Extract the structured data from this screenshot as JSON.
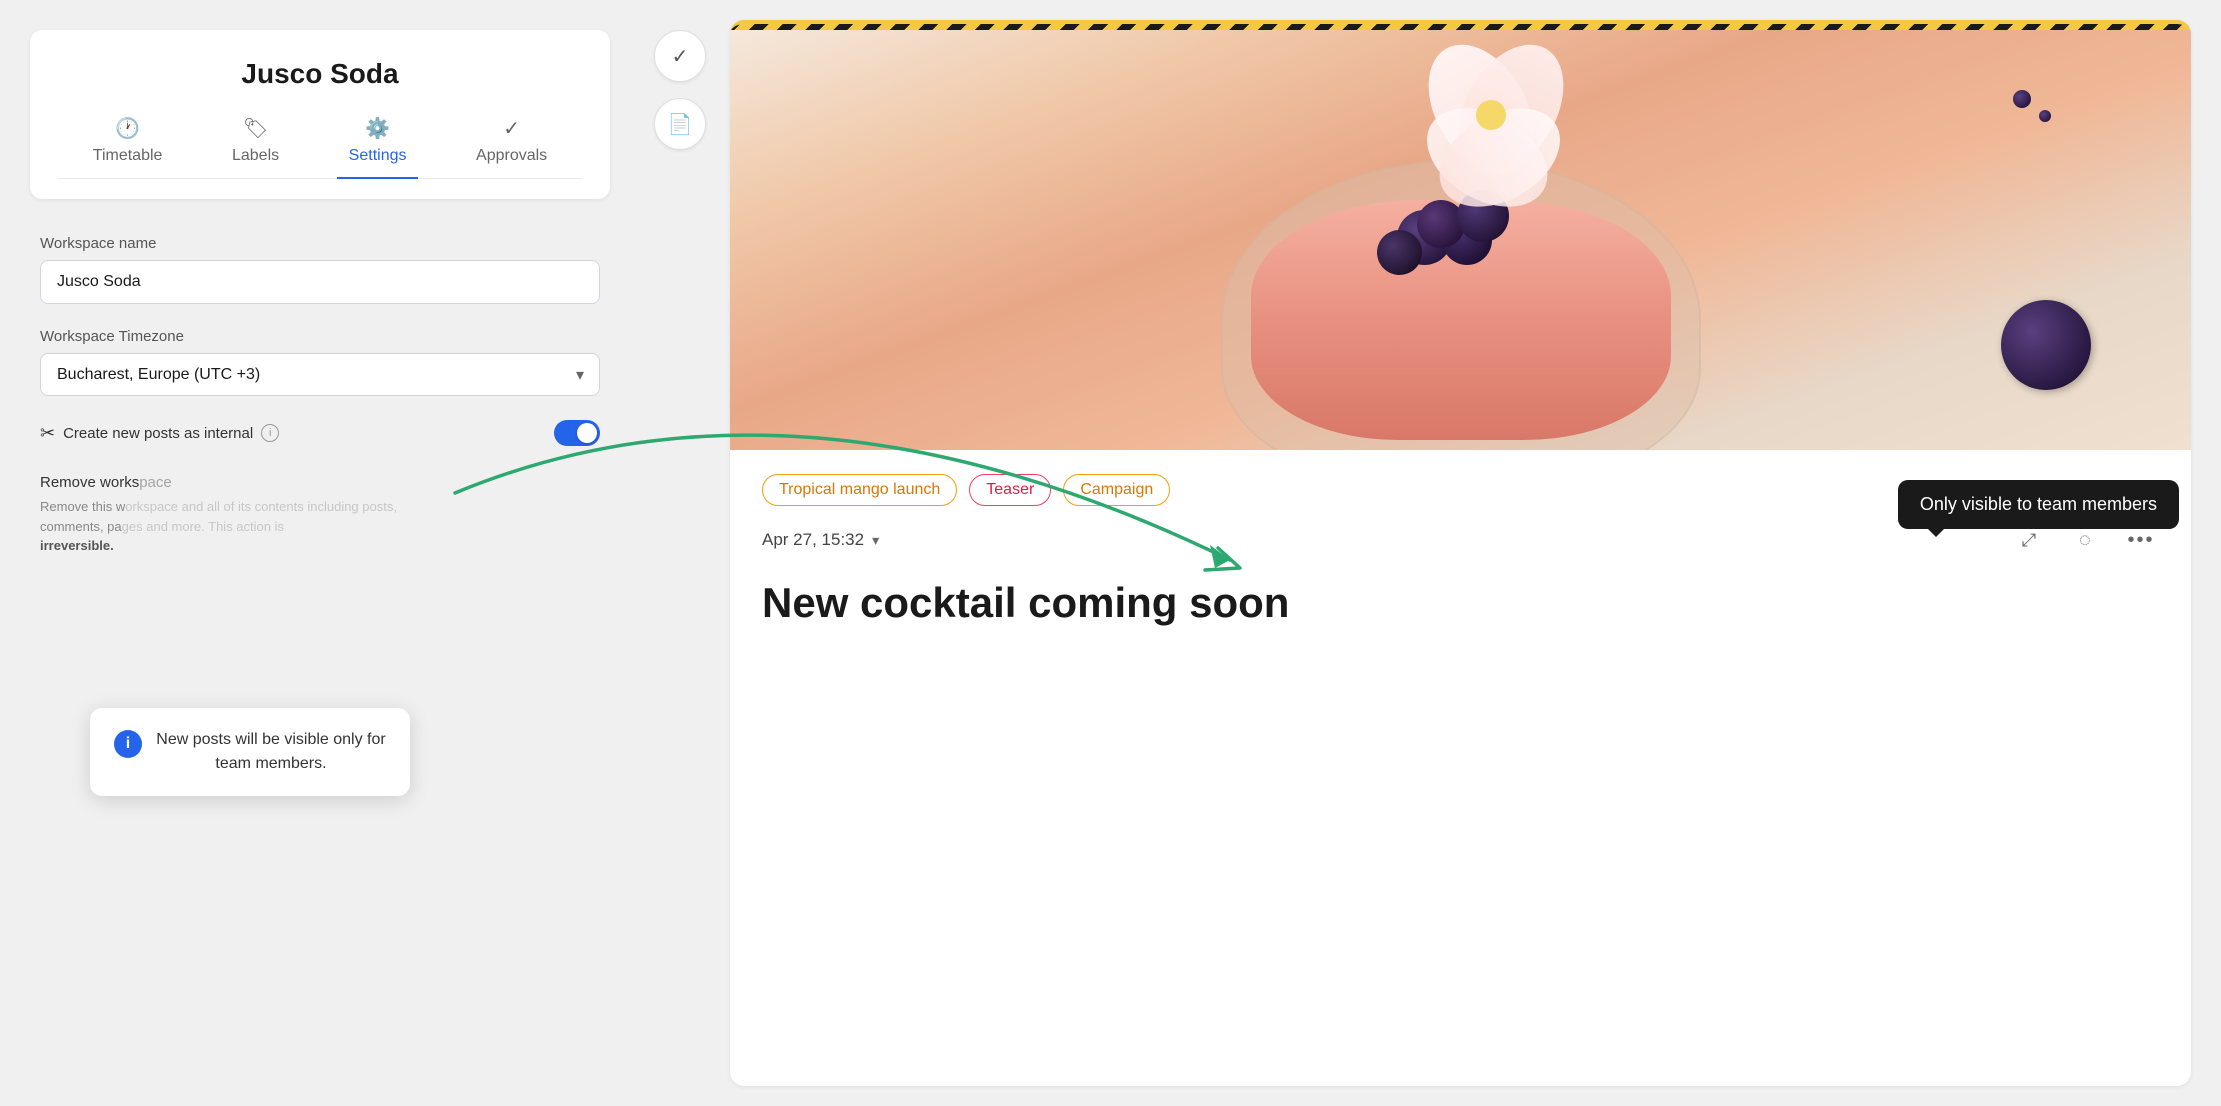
{
  "workspace": {
    "title": "Jusco Soda"
  },
  "tabs": [
    {
      "id": "timetable",
      "label": "Timetable",
      "icon": "🕐",
      "active": false
    },
    {
      "id": "labels",
      "label": "Labels",
      "icon": "🏷",
      "active": false
    },
    {
      "id": "settings",
      "label": "Settings",
      "icon": "⚙️",
      "active": true
    },
    {
      "id": "approvals",
      "label": "Approvals",
      "icon": "✓",
      "active": false
    }
  ],
  "settings": {
    "workspace_name_label": "Workspace name",
    "workspace_name_value": "Jusco Soda",
    "workspace_timezone_label": "Workspace Timezone",
    "workspace_timezone_value": "Bucharest, Europe (UTC +3)",
    "create_internal_label": "Create new posts as internal",
    "toggle_state": true
  },
  "tooltip_popup": {
    "text": "New posts will be visible only for team members."
  },
  "remove_section": {
    "title": "Remove workspace",
    "description": "Remove this workspace and all of its contents including posts, comments, pages and more. This action is",
    "warning": "irreversible."
  },
  "toolbar": {
    "check_label": "✓",
    "doc_label": "📄"
  },
  "post": {
    "tags": [
      {
        "id": "tropical",
        "label": "Tropical mango launch",
        "style": "orange"
      },
      {
        "id": "teaser",
        "label": "Teaser",
        "style": "red"
      },
      {
        "id": "campaign",
        "label": "Campaign",
        "style": "yellow"
      }
    ],
    "date": "Apr 27, 15:32",
    "title": "New cocktail coming soon",
    "visibility_tooltip": "Only visible to team members"
  },
  "icons": {
    "chevron_down": "▾",
    "expand": "⤢",
    "eye_off": "◌",
    "more": "···",
    "info": "i",
    "scissors": "✂"
  }
}
